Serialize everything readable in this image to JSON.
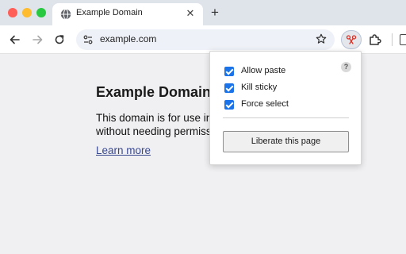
{
  "browser": {
    "tab": {
      "title": "Example Domain",
      "close_glyph": "✕"
    },
    "new_tab_glyph": "+",
    "omnibox": {
      "url": "example.com"
    }
  },
  "page": {
    "heading": "Example Domain",
    "body": "This domain is for use in documentation examples without needing permission. Avoid use in operations.",
    "link": "Learn more"
  },
  "popup": {
    "help_glyph": "?",
    "options": [
      {
        "label": "Allow paste",
        "checked": true
      },
      {
        "label": "Kill sticky",
        "checked": true
      },
      {
        "label": "Force select",
        "checked": true
      }
    ],
    "button_label": "Liberate this page"
  },
  "colors": {
    "accent": "#1a73e8",
    "link": "#38488f",
    "extension_icon": "#d93025"
  },
  "icons": [
    "globe-icon",
    "close-icon",
    "plus-icon",
    "back-arrow-icon",
    "forward-arrow-icon",
    "reload-icon",
    "site-info-icon",
    "star-icon",
    "scissors-icon",
    "puzzle-icon",
    "side-panel-icon",
    "help-icon"
  ]
}
